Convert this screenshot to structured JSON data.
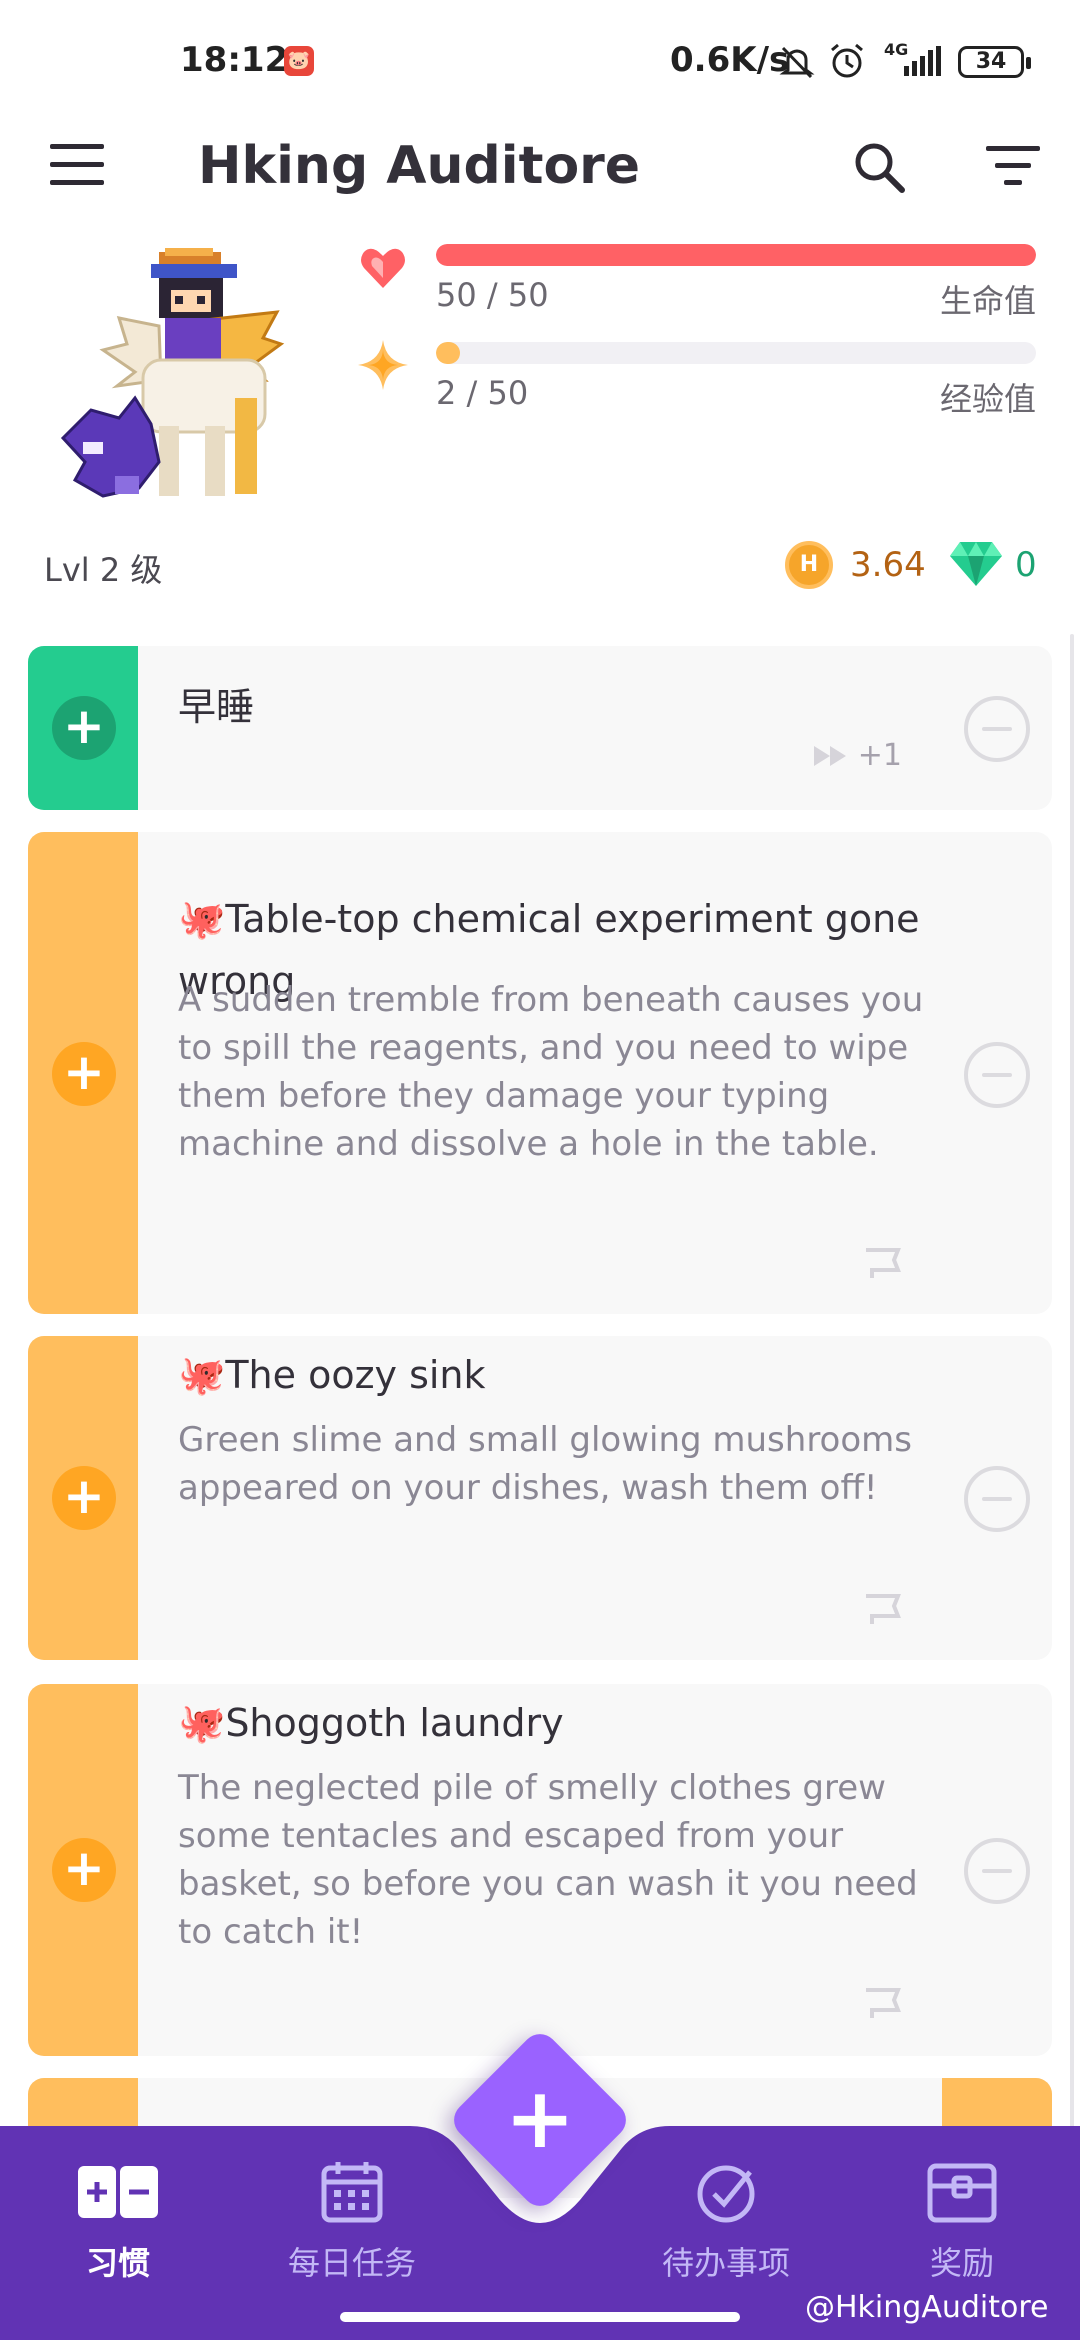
{
  "status_bar": {
    "time": "18:12",
    "app_badge": "🐷",
    "net_speed": "0.6K/s",
    "network": "4G",
    "battery": "34"
  },
  "toolbar": {
    "title": "Hking Auditore"
  },
  "stats": {
    "health": {
      "value": "50 / 50",
      "label": "生命值",
      "fraction": 1.0,
      "color": "#ff6165"
    },
    "experience": {
      "value": "2 / 50",
      "label": "经验值",
      "fraction": 0.04,
      "color": "#ffbe5d"
    },
    "level": "Lvl 2 级",
    "gold": "3.64",
    "gems": "0"
  },
  "tasks": [
    {
      "title": "早睡",
      "notes": "",
      "streak": "+1",
      "color": "green"
    },
    {
      "title": "🐙Table-top chemical experiment gone wrong",
      "notes": "A sudden tremble from beneath causes you to spill the reagents, and you need to wipe them before they damage your typing machine and dissolve a hole in the table.",
      "color": "orange"
    },
    {
      "title": "🐙The oozy sink",
      "notes": "Green slime and small glowing mushrooms appeared on your dishes, wash them off!",
      "color": "orange"
    },
    {
      "title": "🐙Shoggoth laundry",
      "notes": "The neglected pile of smelly clothes grew some tentacles and escaped from your basket, so before you can wash it you need to catch it!",
      "color": "orange"
    }
  ],
  "bottom_nav": {
    "items": [
      {
        "label": "习惯",
        "icon": "habits-icon",
        "active": true
      },
      {
        "label": "每日任务",
        "icon": "calendar-icon",
        "active": false
      },
      {
        "label": "待办事项",
        "icon": "checkmark-icon",
        "active": false
      },
      {
        "label": "奖励",
        "icon": "treasure-chest-icon",
        "active": false
      }
    ],
    "fab_label": "+"
  },
  "watermark": "@HkingAuditore",
  "colors": {
    "nav_bg": "#6133b4",
    "fab": "#9a62ff",
    "habit_green": "#24cc8f",
    "habit_orange": "#ffbe5d"
  }
}
